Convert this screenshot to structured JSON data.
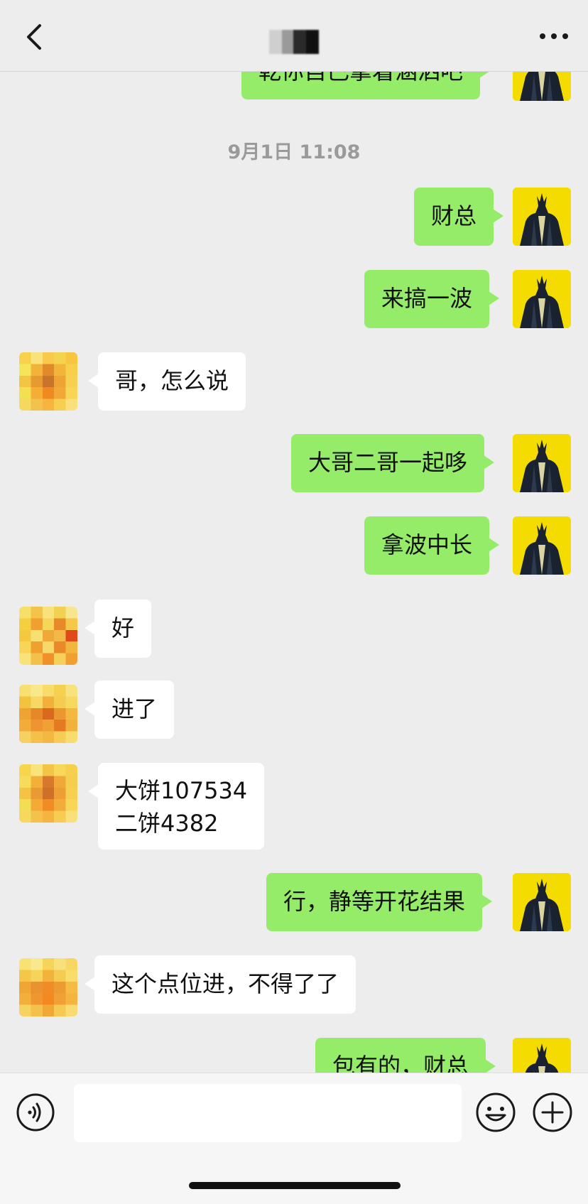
{
  "header": {
    "title_visible_fragment": ""
  },
  "chat": {
    "top_partial_message": "乾你自己拿着涵泗吧",
    "timestamp": "9月1日 11:08",
    "messages": [
      {
        "side": "right",
        "text": "财总"
      },
      {
        "side": "right",
        "text": "来搞一波"
      },
      {
        "side": "left",
        "text": "哥，怎么说"
      },
      {
        "side": "right",
        "text": "大哥二哥一起哆"
      },
      {
        "side": "right",
        "text": "拿波中长"
      },
      {
        "side": "left",
        "text": "好"
      },
      {
        "side": "left",
        "text": "进了"
      },
      {
        "side": "left",
        "text_line1": "大饼107534",
        "text_line2": "二饼4382"
      },
      {
        "side": "right",
        "text": "行，静等开花结果"
      },
      {
        "side": "left",
        "text": "这个点位进，不得了了"
      },
      {
        "side": "right",
        "text": "包有的，财总"
      }
    ]
  },
  "input_bar": {
    "input_value": ""
  },
  "icons": {
    "back": "chevron-left-icon",
    "more": "more-dots-icon",
    "voice": "voice-icon",
    "emoji": "emoji-icon",
    "plus": "plus-icon"
  },
  "colors": {
    "outgoing_bubble": "#95ec69",
    "incoming_bubble": "#ffffff",
    "background": "#ededed"
  }
}
